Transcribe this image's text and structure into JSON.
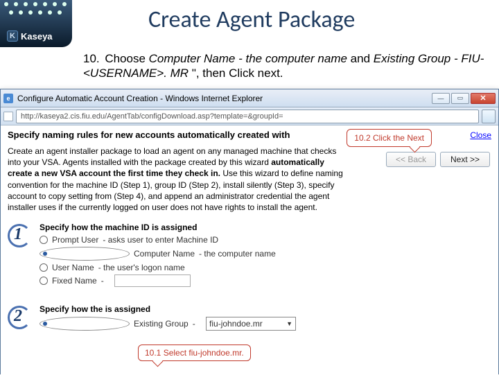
{
  "logo": {
    "brand": "Kaseya",
    "k": "K"
  },
  "title": "Create Agent Package",
  "step": {
    "num": "10.",
    "pre": "Choose ",
    "i1": "Computer Name - the computer name",
    "mid": " and ",
    "i2": "Existing Group - FIU-<USERNAME>. MR",
    "post": " \", then Click next."
  },
  "browser": {
    "window_title": "Configure Automatic Account Creation - Windows Internet Explorer",
    "url": "http://kaseya2.cis.fiu.edu/AgentTab/configDownload.asp?template=&groupId=",
    "min": "—",
    "max": "▭",
    "close": "✕"
  },
  "page": {
    "heading": "Specify naming rules for new accounts automatically created with",
    "close": "Close",
    "back": "<< Back",
    "next": "Next >>",
    "callout_next": "10.2 Click the Next",
    "para_pre": "Create an agent installer package to load an agent on any managed machine that checks into your VSA. Agents installed with the package created by this wizard ",
    "para_bold": "automatically create a new VSA account the first time they check in.",
    "para_post": " Use this wizard to define naming convention for the machine ID (Step 1), group ID (Step 2), install silently (Step 3), specify account to copy setting from (Step 4), and append an administrator credential the agent installer uses if the currently logged on user does not have rights to install the agent.",
    "sec1_title": "Specify how the machine ID is assigned",
    "opts": [
      {
        "label": "Prompt User",
        "desc": " - asks user to enter Machine ID",
        "sel": false
      },
      {
        "label": "Computer Name",
        "desc": " - the computer name",
        "sel": true
      },
      {
        "label": "User Name",
        "desc": " - the user's logon name",
        "sel": false
      },
      {
        "label": "Fixed Name",
        "desc": " -",
        "sel": false
      }
    ],
    "callout_sel": "10.1 Select fiu-johndoe.mr.",
    "sec2_title_a": "Specify how the ",
    "sec2_title_b": " is assigned",
    "grp_label": "Existing Group",
    "grp_desc": " -",
    "grp_value": "fiu-johndoe.mr"
  }
}
